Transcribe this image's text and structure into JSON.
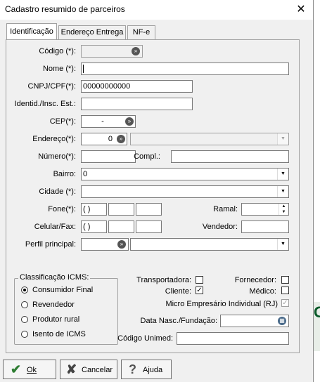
{
  "window": {
    "title": "Cadastro resumido de parceiros",
    "close_glyph": "✕"
  },
  "tabs": [
    "Identificação",
    "Endereço Entrega",
    "NF-e"
  ],
  "form": {
    "codigo_label": "Código (*):",
    "nome_label": "Nome (*):",
    "cnpj_label": "CNPJ/CPF(*):",
    "cnpj_value": "00000000000",
    "identid_label": "Identid./Insc. Est.:",
    "cep_label": "CEP(*):",
    "cep_value": "-",
    "endereco_label": "Endereço(*):",
    "endereco_value": "0",
    "numero_label": "Número(*):",
    "compl_label": "Compl.:",
    "bairro_label": "Bairro:",
    "bairro_value": "0",
    "cidade_label": "Cidade (*):",
    "fone_label": "Fone(*):",
    "fone_ddd": "(  )",
    "ramal_label": "Ramal:",
    "celular_label": "Celular/Fax:",
    "celular_ddd": "(  )",
    "vendedor_label": "Vendedor:",
    "perfil_label": "Perfil principal:"
  },
  "classificacao": {
    "title": "Classificação ICMS:",
    "options": [
      "Consumidor Final",
      "Revendedor",
      "Produtor rural",
      "Isento de ICMS"
    ],
    "selected": "Consumidor Final"
  },
  "flags": {
    "transportadora": "Transportadora:",
    "fornecedor": "Fornecedor:",
    "cliente": "Cliente:",
    "medico": "Médico:",
    "micro": "Micro Empresário Individual (RJ)",
    "data_nasc": "Data Nasc./Fundação:",
    "codigo_unimed": "Código Unimed:"
  },
  "buttons": {
    "ok": "Ok",
    "cancelar": "Cancelar",
    "ajuda": "Ajuda"
  },
  "edge_text": "G"
}
